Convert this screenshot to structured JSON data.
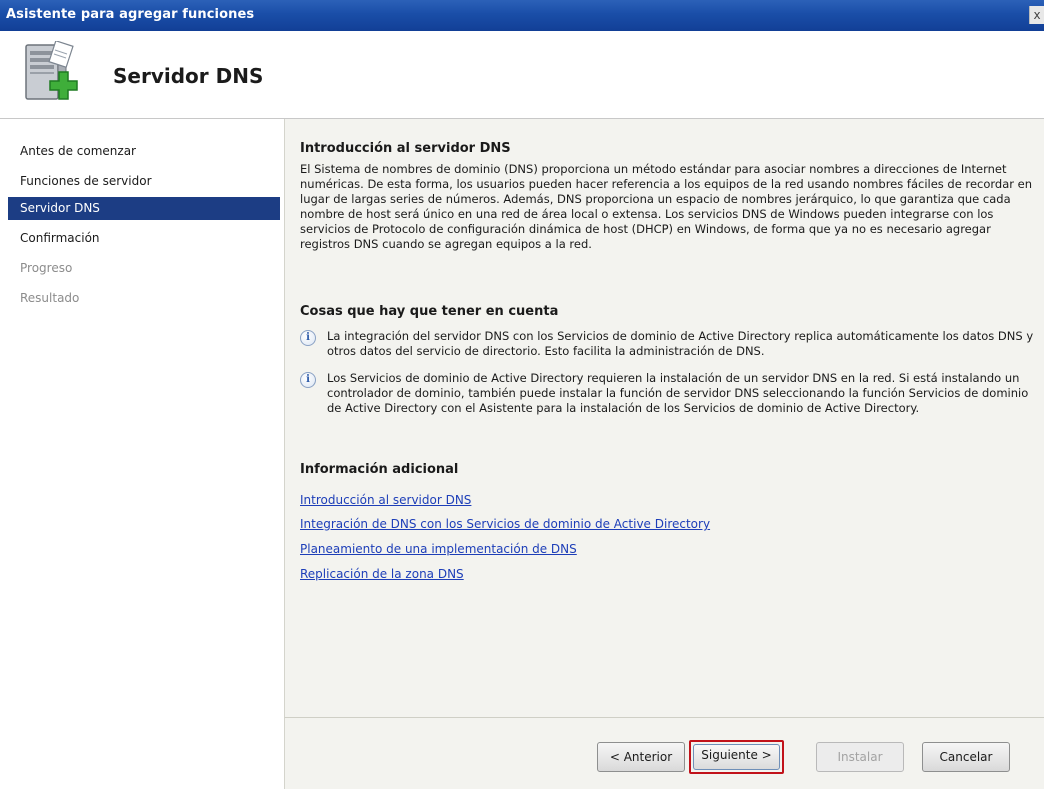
{
  "window": {
    "title": "Asistente para agregar funciones",
    "close_glyph": "x"
  },
  "header": {
    "icon": "server-add-icon",
    "title": "Servidor DNS"
  },
  "sidebar": {
    "items": [
      {
        "label": "Antes de comenzar",
        "state": "normal"
      },
      {
        "label": "Funciones de servidor",
        "state": "normal"
      },
      {
        "label": "Servidor DNS",
        "state": "selected"
      },
      {
        "label": "Confirmación",
        "state": "normal"
      },
      {
        "label": "Progreso",
        "state": "disabled"
      },
      {
        "label": "Resultado",
        "state": "disabled"
      }
    ]
  },
  "content": {
    "intro_heading": "Introducción al servidor DNS",
    "intro_text": "El Sistema de nombres de dominio (DNS) proporciona un método estándar para asociar nombres a direcciones de Internet numéricas. De esta forma, los usuarios pueden hacer referencia a los equipos de la red usando nombres fáciles de recordar en lugar de largas series de números. Además, DNS proporciona un espacio de nombres jerárquico, lo que garantiza que cada nombre de host será único en una red de área local o extensa. Los servicios DNS de Windows pueden integrarse con los servicios de Protocolo de configuración dinámica de host (DHCP) en Windows, de forma que ya no es necesario agregar registros DNS cuando se agregan equipos a la red.",
    "notes_heading": "Cosas que hay que tener en cuenta",
    "notes": [
      "La integración del servidor DNS con los Servicios de dominio de Active Directory replica automáticamente los datos DNS y otros datos del servicio de directorio. Esto facilita la administración de DNS.",
      "Los Servicios de dominio de Active Directory requieren la instalación de un servidor DNS en la red. Si está instalando un controlador de dominio, también puede instalar la función de servidor DNS seleccionando la función Servicios de dominio de Active Directory con el Asistente para la instalación de los Servicios de dominio de Active Directory."
    ],
    "more_heading": "Información adicional",
    "links": [
      "Introducción al servidor DNS",
      "Integración de DNS con los Servicios de dominio de Active Directory",
      "Planeamiento de una implementación de DNS",
      "Replicación de la zona DNS"
    ]
  },
  "buttons": {
    "back": "< Anterior",
    "next": "Siguiente >",
    "install": "Instalar",
    "cancel": "Cancelar"
  },
  "colors": {
    "titlebar": "#1a4ea8",
    "selected": "#1c3d84",
    "link": "#1d3eb8",
    "highlight": "#c1121a"
  }
}
